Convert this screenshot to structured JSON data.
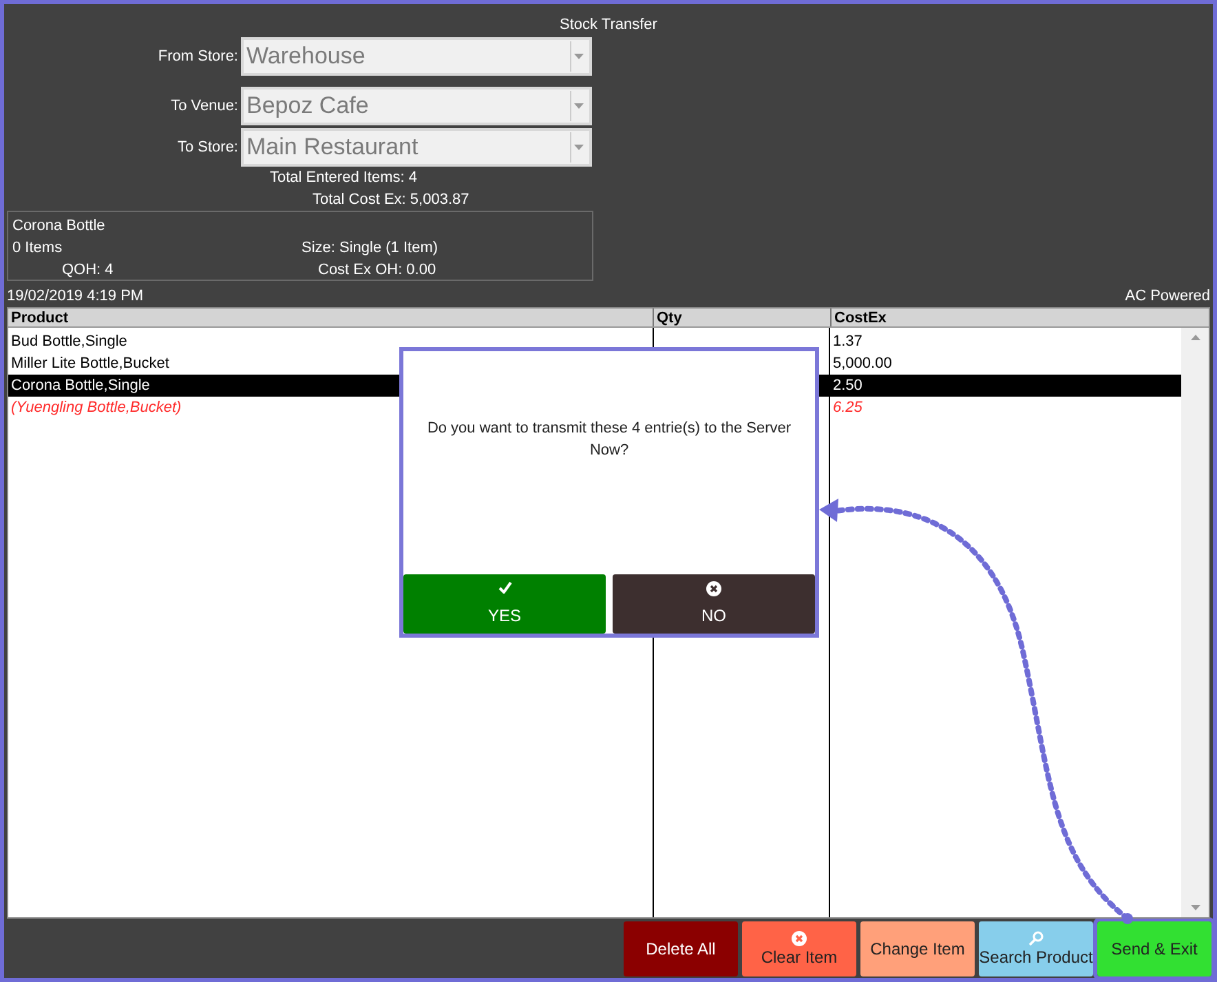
{
  "window": {
    "title": "Stock Transfer"
  },
  "form": [
    {
      "label": "From Store:",
      "value": "Warehouse"
    },
    {
      "label": "To Venue:",
      "value": "Bepoz Cafe"
    },
    {
      "label": "To Store:",
      "value": "Main Restaurant"
    }
  ],
  "totals": [
    "Total Entered Items: 4",
    "Total Cost Ex: 5,003.87"
  ],
  "item_info": {
    "name": "Corona Bottle",
    "items": "0 Items",
    "size": "Size: Single (1 Item)",
    "qoh": "QOH:  4",
    "cost_oh": "Cost Ex OH: 0.00"
  },
  "status": {
    "datetime": "19/02/2019 4:19 PM",
    "power": "AC Powered"
  },
  "table": {
    "columns": [
      "Product",
      "Qty",
      "CostEx"
    ],
    "rows": [
      {
        "product": "Bud Bottle,Single",
        "cost": "1.37",
        "selected": false,
        "removed": false
      },
      {
        "product": "Miller Lite Bottle,Bucket",
        "cost": "5,000.00",
        "selected": false,
        "removed": false
      },
      {
        "product": "Corona Bottle,Single",
        "cost": "2.50",
        "selected": true,
        "removed": false
      },
      {
        "product": "(Yuengling Bottle,Bucket)",
        "cost": "6.25",
        "selected": false,
        "removed": true
      }
    ]
  },
  "dialog": {
    "message": "Do you want to transmit these 4 entrie(s) to the Server Now?",
    "buttons": [
      {
        "label": "YES",
        "kind": "yes"
      },
      {
        "label": "NO",
        "kind": "no"
      }
    ]
  },
  "buttons": [
    {
      "label": "Delete All",
      "kind": "delete",
      "highlighted": false
    },
    {
      "label": "Clear Item",
      "kind": "clear",
      "highlighted": false
    },
    {
      "label": "Change Item",
      "kind": "change",
      "highlighted": false
    },
    {
      "label": "Search Product",
      "kind": "search",
      "highlighted": false
    },
    {
      "label": "Send & Exit",
      "kind": "send",
      "highlighted": true
    }
  ]
}
